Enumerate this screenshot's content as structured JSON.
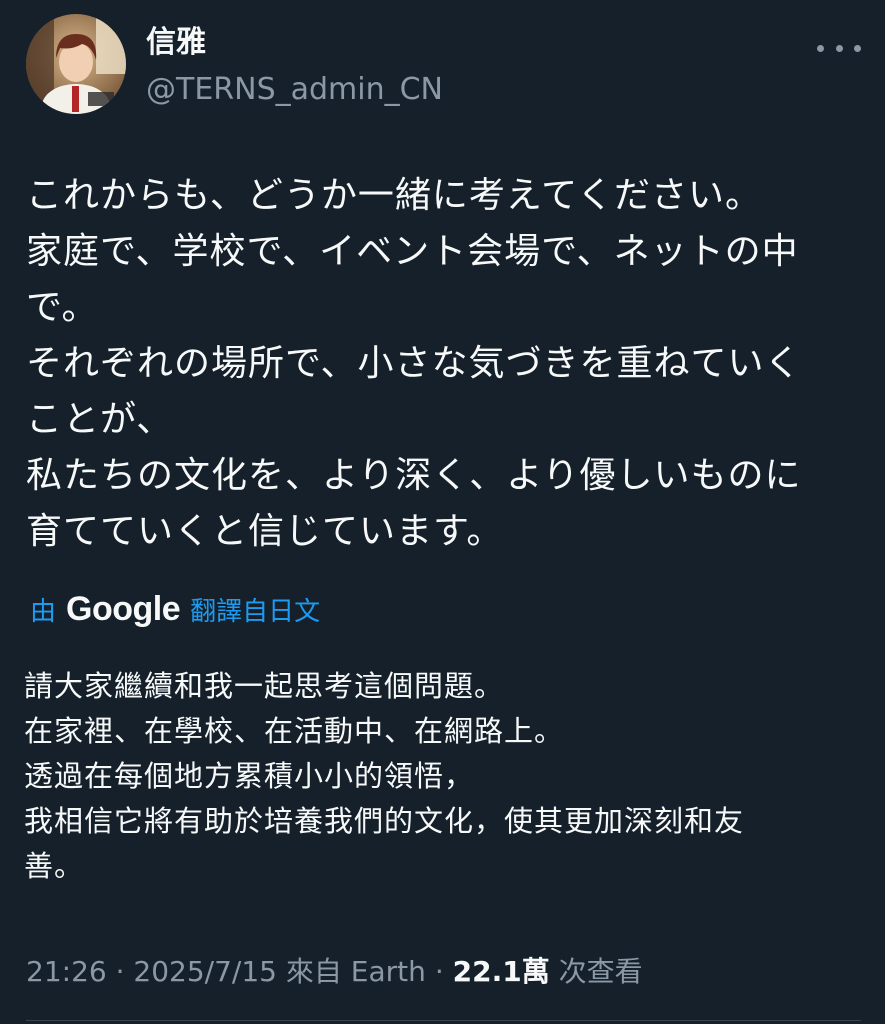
{
  "user": {
    "display_name": "信雅",
    "handle": "@TERNS_admin_CN",
    "avatar_icon": "avatar-portrait"
  },
  "more_icon": "more-horizontal-icon",
  "tweet": {
    "lines": [
      "これからも、どうか一緒に考えてください。",
      "家庭で、学校で、イベント会場で、ネットの中",
      "で。",
      "それぞれの場所で、小さな気づきを重ねていく",
      "ことが、",
      "私たちの文化を、より深く、より優しいものに",
      "育てていくと信じています。"
    ]
  },
  "translation": {
    "by_label": "由",
    "provider": "Google",
    "link_label": "翻譯自日文",
    "lines": [
      "請大家繼續和我一起思考這個問題。",
      "在家裡、在學校、在活動中、在網路上。",
      "透過在每個地方累積小小的領悟，",
      "我相信它將有助於培養我們的文化，使其更加深刻和友",
      "善。"
    ]
  },
  "meta": {
    "time": "21:26",
    "date": "2025/7/15",
    "source": "來自 Earth",
    "sep": "·",
    "views_count": "22.1萬",
    "views_label": "次查看"
  },
  "colors": {
    "background": "#15202b",
    "text": "#f7f9f9",
    "secondary": "#8b98a5",
    "link": "#1d9bf0"
  }
}
